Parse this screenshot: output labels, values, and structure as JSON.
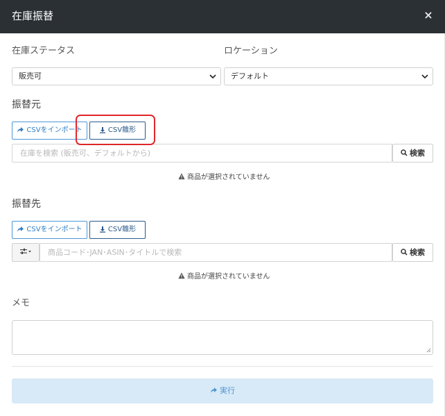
{
  "dialog": {
    "title": "在庫振替",
    "close": "×"
  },
  "status": {
    "label": "在庫ステータス",
    "selected": "販売可"
  },
  "location": {
    "label": "ロケーション",
    "selected": "デフォルト"
  },
  "source": {
    "title": "振替元",
    "import_label": "CSVをインポート",
    "template_label": "CSV雛形",
    "search_placeholder": "在庫を検索 (販売可、デフォルトから)",
    "search_button": "検索",
    "empty_notice": "商品が選択されていません"
  },
  "destination": {
    "title": "振替先",
    "import_label": "CSVをインポート",
    "template_label": "CSV雛形",
    "search_placeholder": "商品コード･JAN･ASIN･タイトルで検索",
    "search_button": "検索",
    "empty_notice": "商品が選択されていません"
  },
  "memo": {
    "label": "メモ",
    "value": ""
  },
  "execute": {
    "label": "実行"
  },
  "icons": {
    "close": "close-icon",
    "share": "share-icon",
    "download": "download-icon",
    "search": "search-icon",
    "warning": "warning-icon",
    "sliders": "sliders-icon",
    "chevron": "chevron-down-icon"
  },
  "colors": {
    "header_bg": "#2b3035",
    "import_blue": "#2f7ec6",
    "execute_bg": "#d8e9f7",
    "highlight_red": "#e0262b"
  }
}
